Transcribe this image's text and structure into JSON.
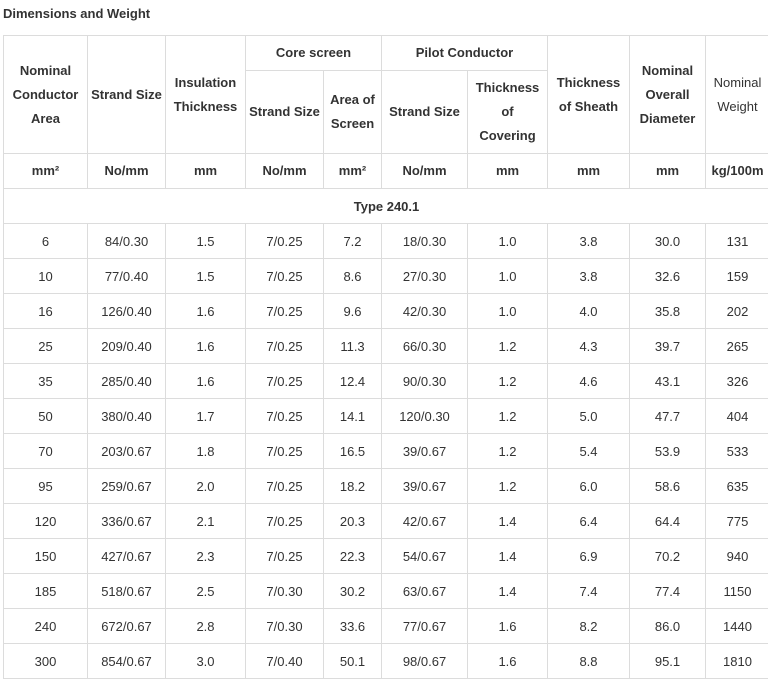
{
  "title": "Dimensions and Weight",
  "header": {
    "nominal_area": [
      "Nominal",
      "Conductor",
      "Area"
    ],
    "strand_size": "Strand Size",
    "insulation": [
      "Insulation",
      "Thickness"
    ],
    "core_screen": "Core screen",
    "core_strand": "Strand Size",
    "core_area": [
      "Area of",
      "Screen"
    ],
    "pilot_conductor": "Pilot Conductor",
    "pilot_strand": "Strand Size",
    "pilot_thickness": [
      "Thickness",
      "of",
      "Covering"
    ],
    "sheath": [
      "Thickness",
      "of Sheath"
    ],
    "diameter": [
      "Nominal",
      "Overall",
      "Diameter"
    ],
    "weight": [
      "Nominal",
      "Weight"
    ]
  },
  "units": [
    "mm²",
    "No/mm",
    "mm",
    "No/mm",
    "mm²",
    "No/mm",
    "mm",
    "mm",
    "mm",
    "kg/100m"
  ],
  "section_title": "Type 240.1",
  "rows": [
    [
      "6",
      "84/0.30",
      "1.5",
      "7/0.25",
      "7.2",
      "18/0.30",
      "1.0",
      "3.8",
      "30.0",
      "131"
    ],
    [
      "10",
      "77/0.40",
      "1.5",
      "7/0.25",
      "8.6",
      "27/0.30",
      "1.0",
      "3.8",
      "32.6",
      "159"
    ],
    [
      "16",
      "126/0.40",
      "1.6",
      "7/0.25",
      "9.6",
      "42/0.30",
      "1.0",
      "4.0",
      "35.8",
      "202"
    ],
    [
      "25",
      "209/0.40",
      "1.6",
      "7/0.25",
      "11.3",
      "66/0.30",
      "1.2",
      "4.3",
      "39.7",
      "265"
    ],
    [
      "35",
      "285/0.40",
      "1.6",
      "7/0.25",
      "12.4",
      "90/0.30",
      "1.2",
      "4.6",
      "43.1",
      "326"
    ],
    [
      "50",
      "380/0.40",
      "1.7",
      "7/0.25",
      "14.1",
      "120/0.30",
      "1.2",
      "5.0",
      "47.7",
      "404"
    ],
    [
      "70",
      "203/0.67",
      "1.8",
      "7/0.25",
      "16.5",
      "39/0.67",
      "1.2",
      "5.4",
      "53.9",
      "533"
    ],
    [
      "95",
      "259/0.67",
      "2.0",
      "7/0.25",
      "18.2",
      "39/0.67",
      "1.2",
      "6.0",
      "58.6",
      "635"
    ],
    [
      "120",
      "336/0.67",
      "2.1",
      "7/0.25",
      "20.3",
      "42/0.67",
      "1.4",
      "6.4",
      "64.4",
      "775"
    ],
    [
      "150",
      "427/0.67",
      "2.3",
      "7/0.25",
      "22.3",
      "54/0.67",
      "1.4",
      "6.9",
      "70.2",
      "940"
    ],
    [
      "185",
      "518/0.67",
      "2.5",
      "7/0.30",
      "30.2",
      "63/0.67",
      "1.4",
      "7.4",
      "77.4",
      "1150"
    ],
    [
      "240",
      "672/0.67",
      "2.8",
      "7/0.30",
      "33.6",
      "77/0.67",
      "1.6",
      "8.2",
      "86.0",
      "1440"
    ],
    [
      "300",
      "854/0.67",
      "3.0",
      "7/0.40",
      "50.1",
      "98/0.67",
      "1.6",
      "8.8",
      "95.1",
      "1810"
    ]
  ]
}
